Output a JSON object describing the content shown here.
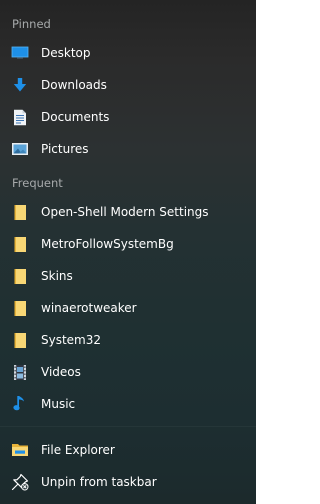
{
  "sections": {
    "pinned": "Pinned",
    "frequent": "Frequent"
  },
  "pinned": [
    {
      "label": "Desktop",
      "icon": "desktop-icon"
    },
    {
      "label": "Downloads",
      "icon": "download-arrow-icon"
    },
    {
      "label": "Documents",
      "icon": "document-icon"
    },
    {
      "label": "Pictures",
      "icon": "pictures-icon"
    }
  ],
  "frequent": [
    {
      "label": "Open-Shell Modern Settings",
      "icon": "folder-icon"
    },
    {
      "label": "MetroFollowSystemBg",
      "icon": "folder-icon"
    },
    {
      "label": "Skins",
      "icon": "folder-icon"
    },
    {
      "label": "winaerotweaker",
      "icon": "folder-icon"
    },
    {
      "label": "System32",
      "icon": "folder-icon"
    },
    {
      "label": "Videos",
      "icon": "videos-icon"
    },
    {
      "label": "Music",
      "icon": "music-note-icon"
    }
  ],
  "tasks": [
    {
      "label": "File Explorer",
      "icon": "file-explorer-icon"
    },
    {
      "label": "Unpin from taskbar",
      "icon": "unpin-icon"
    }
  ],
  "colors": {
    "accent_blue": "#1e90e8",
    "folder_yellow": "#f8d775",
    "section_text": "#a6a9aa"
  }
}
